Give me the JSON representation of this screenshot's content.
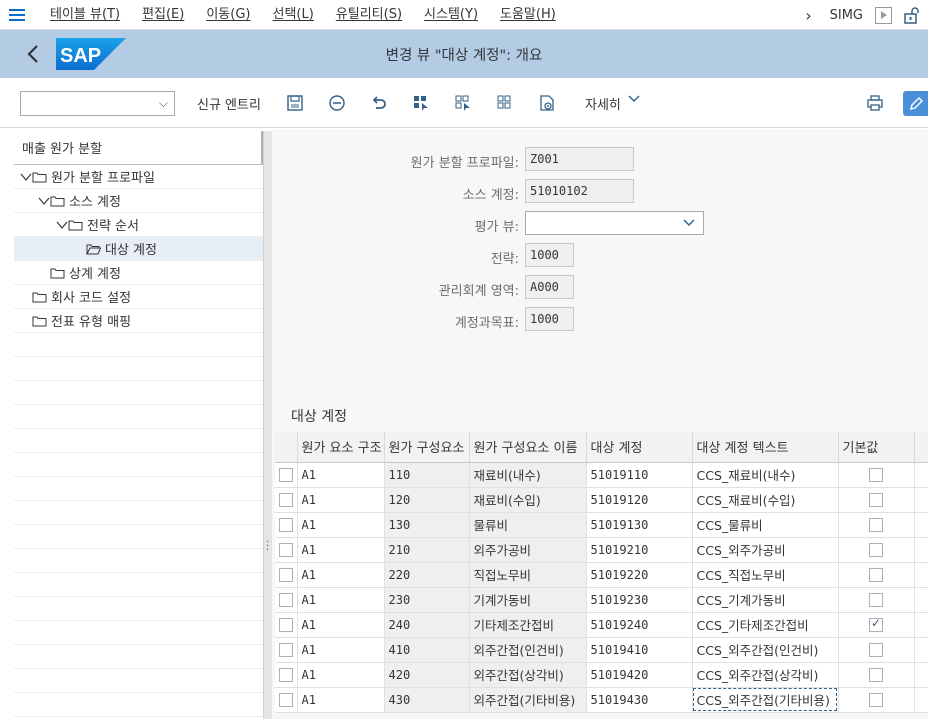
{
  "menubar": {
    "items": [
      "테이블 뷰(T)",
      "편집(E)",
      "이동(G)",
      "선택(L)",
      "유틸리티(S)",
      "시스템(Y)",
      "도움말(H)"
    ],
    "transaction": "SIMG"
  },
  "titlebar": {
    "logo_text": "SAP",
    "title": "변경 뷰 \"대상 계정\": 개요"
  },
  "toolbar": {
    "command_value": "",
    "new_entries_label": "신규 엔트리",
    "details_label": "자세히"
  },
  "tree": {
    "header": "매출 원가 분할",
    "items": [
      {
        "label": "원가 분할 프로파일",
        "expanded": true
      },
      {
        "label": "소스 계정",
        "expanded": true
      },
      {
        "label": "전략 순서",
        "expanded": true
      },
      {
        "label": "대상 계정",
        "selected": true
      },
      {
        "label": "상계 계정"
      },
      {
        "label": "회사 코드 설정"
      },
      {
        "label": "전표 유형 매핑"
      }
    ]
  },
  "form": {
    "profile_label": "원가 분할 프로파일:",
    "profile_value": "Z001",
    "source_account_label": "소스 계정:",
    "source_account_value": "51010102",
    "valuation_view_label": "평가 뷰:",
    "valuation_view_value": "",
    "strategy_label": "전략:",
    "strategy_value": "1000",
    "controlling_area_label": "관리회계 영역:",
    "controlling_area_value": "A000",
    "chart_of_accounts_label": "계정과목표:",
    "chart_of_accounts_value": "1000"
  },
  "section_title": "대상 계정",
  "table": {
    "columns": [
      "원가 요소 구조",
      "원가 구성요소",
      "원가 구성요소 이름",
      "대상 계정",
      "대상 계정 텍스트",
      "기본값"
    ],
    "rows": [
      {
        "structure": "A1",
        "component": "110",
        "name": "재료비(내수)",
        "account": "51019110",
        "text": "CCS_재료비(내수)",
        "default": false
      },
      {
        "structure": "A1",
        "component": "120",
        "name": "재료비(수입)",
        "account": "51019120",
        "text": "CCS_재료비(수입)",
        "default": false
      },
      {
        "structure": "A1",
        "component": "130",
        "name": "물류비",
        "account": "51019130",
        "text": "CCS_물류비",
        "default": false
      },
      {
        "structure": "A1",
        "component": "210",
        "name": "외주가공비",
        "account": "51019210",
        "text": "CCS_외주가공비",
        "default": false
      },
      {
        "structure": "A1",
        "component": "220",
        "name": "직접노무비",
        "account": "51019220",
        "text": "CCS_직접노무비",
        "default": false
      },
      {
        "structure": "A1",
        "component": "230",
        "name": "기계가동비",
        "account": "51019230",
        "text": "CCS_기계가동비",
        "default": false
      },
      {
        "structure": "A1",
        "component": "240",
        "name": "기타제조간접비",
        "account": "51019240",
        "text": "CCS_기타제조간접비",
        "default": true
      },
      {
        "structure": "A1",
        "component": "410",
        "name": "외주간접(인건비)",
        "account": "51019410",
        "text": "CCS_외주간접(인건비)",
        "default": false
      },
      {
        "structure": "A1",
        "component": "420",
        "name": "외주간접(상각비)",
        "account": "51019420",
        "text": "CCS_외주간접(상각비)",
        "default": false
      },
      {
        "structure": "A1",
        "component": "430",
        "name": "외주간접(기타비용)",
        "account": "51019430",
        "text": "CCS_외주간접(기타비용)",
        "default": false
      }
    ]
  },
  "colors": {
    "accent": "#0a6ed1",
    "titlebar_bg": "#b3cbe3",
    "icon": "#346187"
  },
  "icons": [
    "menu-icon",
    "chevron-right-icon",
    "play-icon",
    "lock-icon",
    "back-icon",
    "save-icon",
    "minus-circle-icon",
    "undo-icon",
    "select-all-icon",
    "deselect-icon",
    "block-icon",
    "settings-icon",
    "print-icon",
    "edit-icon",
    "folder-icon"
  ]
}
